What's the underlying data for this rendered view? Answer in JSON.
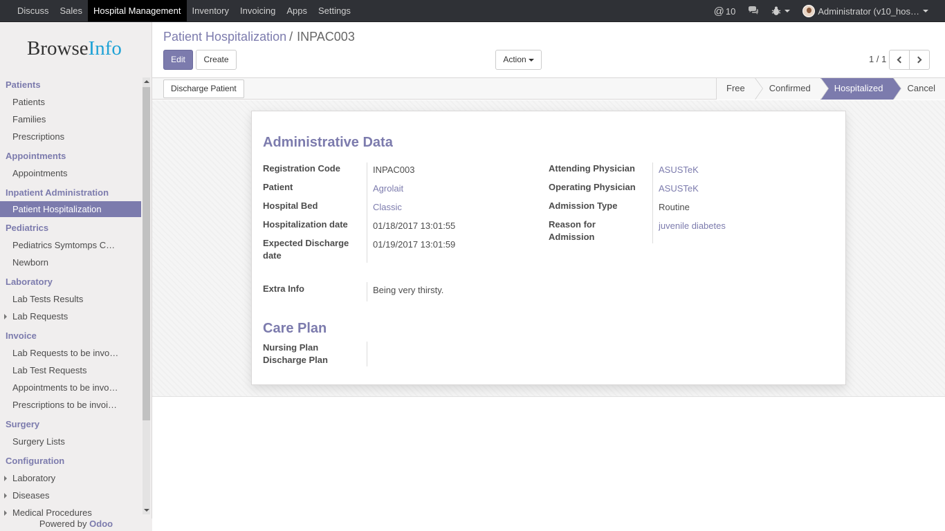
{
  "topbar": {
    "menu": [
      "Discuss",
      "Sales",
      "Hospital Management",
      "Inventory",
      "Invoicing",
      "Apps",
      "Settings"
    ],
    "active_menu": "Hospital Management",
    "messages_count": "10",
    "user_label": "Administrator (v10_hos…"
  },
  "sidebar": {
    "logo_part1": "Browse",
    "logo_part2": "Info",
    "powered_prefix": "Powered by ",
    "powered_brand": "Odoo",
    "sections": [
      {
        "title": "Patients",
        "items": [
          {
            "label": "Patients"
          },
          {
            "label": "Families"
          },
          {
            "label": "Prescriptions"
          }
        ]
      },
      {
        "title": "Appointments",
        "items": [
          {
            "label": "Appointments"
          }
        ]
      },
      {
        "title": "Inpatient Administration",
        "items": [
          {
            "label": "Patient Hospitalization",
            "active": true
          }
        ]
      },
      {
        "title": "Pediatrics",
        "items": [
          {
            "label": "Pediatrics Symtomps C…"
          },
          {
            "label": "Newborn"
          }
        ]
      },
      {
        "title": "Laboratory",
        "items": [
          {
            "label": "Lab Tests Results"
          },
          {
            "label": "Lab Requests",
            "expandable": true
          }
        ]
      },
      {
        "title": "Invoice",
        "items": [
          {
            "label": "Lab Requests to be invo…"
          },
          {
            "label": "Lab Test Requests"
          },
          {
            "label": "Appointments to be invo…"
          },
          {
            "label": "Prescriptions to be invoi…"
          }
        ]
      },
      {
        "title": "Surgery",
        "items": [
          {
            "label": "Surgery Lists"
          }
        ]
      },
      {
        "title": "Configuration",
        "items": [
          {
            "label": "Laboratory",
            "expandable": true
          },
          {
            "label": "Diseases",
            "expandable": true
          },
          {
            "label": "Medical Procedures",
            "expandable": true
          }
        ]
      }
    ]
  },
  "breadcrumb": {
    "parent": "Patient Hospitalization",
    "separator": "/",
    "current": "INPAC003"
  },
  "buttons": {
    "edit": "Edit",
    "create": "Create",
    "action": "Action"
  },
  "pager": {
    "text": "1 / 1"
  },
  "statusbar": {
    "discharge_button": "Discharge Patient",
    "stages": [
      "Free",
      "Confirmed",
      "Hospitalized",
      "Cancel"
    ],
    "current_stage": "Hospitalized"
  },
  "form": {
    "admin_title": "Administrative Data",
    "left": {
      "registration_code_label": "Registration Code",
      "registration_code": "INPAC003",
      "patient_label": "Patient",
      "patient": "Agrolait",
      "hospital_bed_label": "Hospital Bed",
      "hospital_bed": "Classic",
      "hospitalization_date_label": "Hospitalization date",
      "hospitalization_date": "01/18/2017 13:01:55",
      "expected_discharge_label_1": "Expected Discharge",
      "expected_discharge_label_2": "date",
      "expected_discharge": "01/19/2017 13:01:59"
    },
    "right": {
      "attending_physician_label": "Attending Physician",
      "attending_physician": "ASUSTeK",
      "operating_physician_label": "Operating Physician",
      "operating_physician": "ASUSTeK",
      "admission_type_label": "Admission Type",
      "admission_type": "Routine",
      "reason_label_1": "Reason for",
      "reason_label_2": "Admission",
      "reason": "juvenile diabetes"
    },
    "extra_info_label": "Extra Info",
    "extra_info": "Being very thirsty.",
    "care_plan_title": "Care Plan",
    "nursing_plan_label": "Nursing Plan",
    "discharge_plan_label": "Discharge Plan"
  }
}
